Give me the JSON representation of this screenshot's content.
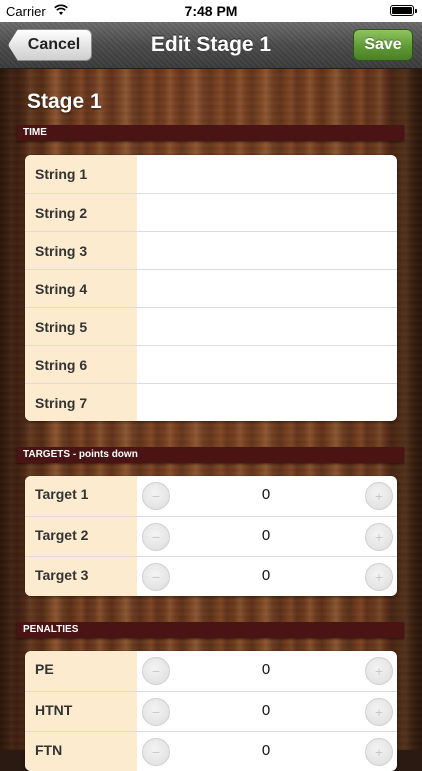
{
  "status_bar": {
    "carrier": "Carrier",
    "time": "7:48 PM"
  },
  "nav": {
    "title": "Edit Stage 1",
    "cancel_label": "Cancel",
    "save_label": "Save"
  },
  "stage_title": "Stage 1",
  "time_section": {
    "header": "TIME",
    "rows": [
      "String 1",
      "String 2",
      "String 3",
      "String 4",
      "String 5",
      "String 6",
      "String 7"
    ]
  },
  "targets_section": {
    "header": "TARGETS - points down",
    "rows": [
      {
        "label": "Target 1",
        "value": "0"
      },
      {
        "label": "Target 2",
        "value": "0"
      },
      {
        "label": "Target 3",
        "value": "0"
      }
    ]
  },
  "penalties_section": {
    "header": "PENALTIES",
    "rows": [
      {
        "label": "PE",
        "value": "0"
      },
      {
        "label": "HTNT",
        "value": "0"
      },
      {
        "label": "FTN",
        "value": "0"
      }
    ]
  },
  "stepper": {
    "minus_glyph": "−",
    "plus_glyph": "+"
  },
  "colors": {
    "label_bg": "#fdebcf",
    "section_header_bg": "#4a1414",
    "save_green": "#5f9a35"
  }
}
